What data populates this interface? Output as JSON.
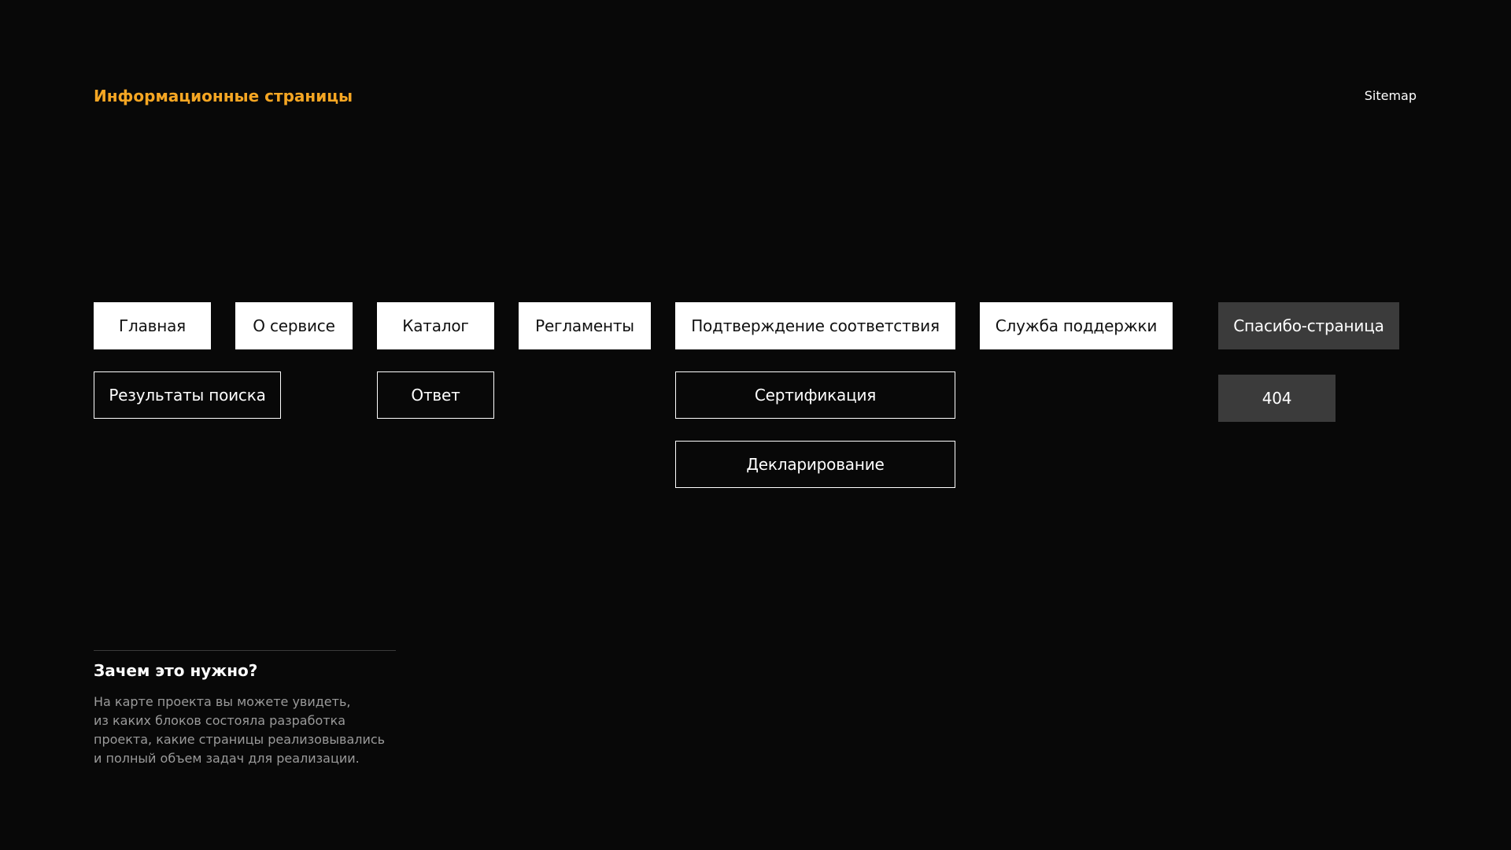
{
  "header": {
    "title": "Информационные страницы",
    "link": "Sitemap"
  },
  "colors": {
    "accent": "#f5a623",
    "background": "#080808",
    "node_primary_bg": "#ffffff",
    "node_service_bg": "#3b3b3b",
    "muted_text": "#9a9a9a"
  },
  "nodes": {
    "home": "Главная",
    "about": "О сервисе",
    "catalog": "Каталог",
    "regulations": "Регламенты",
    "conformity": "Подтверждение соответствия",
    "support": "Служба поддержки",
    "thanks": "Спасибо-страница",
    "search_results": "Результаты поиска",
    "answer": "Ответ",
    "certification": "Сертификация",
    "declaration": "Декларирование",
    "not_found": "404"
  },
  "info": {
    "heading": "Зачем это нужно?",
    "lines": [
      "На карте проекта вы можете увидеть,",
      "из каких блоков состояла разработка",
      "проекта, какие страницы реализовывались",
      "и полный объем задач для реализации."
    ]
  }
}
